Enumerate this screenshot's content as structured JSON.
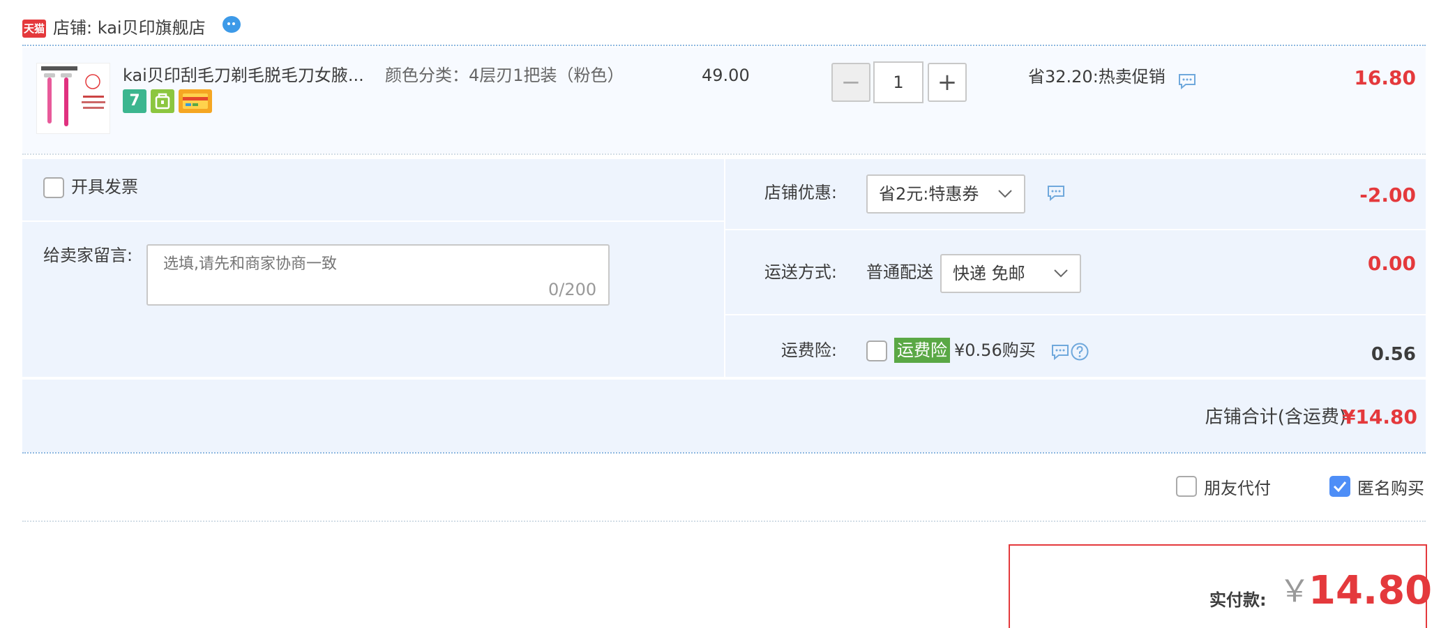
{
  "store": {
    "badge": "天猫",
    "name_text": "店铺: kai贝印旗舰店"
  },
  "item": {
    "title": "kai贝印刮毛刀剃毛脱毛刀女腋...",
    "sku": "颜色分类：4层刃1把装（粉色）",
    "unit_price": "49.00",
    "quantity": "1",
    "promo": "省32.20:热卖促销",
    "total": "16.80",
    "tags": [
      "7",
      "",
      ""
    ],
    "qty_dec_symbol": "−",
    "qty_inc_symbol": "+"
  },
  "invoice": {
    "label": "开具发票"
  },
  "message": {
    "label": "给卖家留言:",
    "placeholder": "选填,请先和商家协商一致",
    "counter": "0/200"
  },
  "discount": {
    "label": "店铺优惠:",
    "selected": "省2元:特惠券",
    "amount": "-2.00"
  },
  "shipping": {
    "label": "运送方式:",
    "type": "普通配送",
    "selected": "快递 免邮",
    "amount": "0.00"
  },
  "insurance": {
    "label": "运费险:",
    "badge": "运费险",
    "price_text": "¥0.56购买",
    "amount": "0.56"
  },
  "store_total": {
    "label": "店铺合计(含运费)",
    "value": "¥14.80"
  },
  "pay_options": {
    "friend_pay": "朋友代付",
    "anonymous": "匿名购买",
    "anonymous_checked": true
  },
  "final": {
    "label": "实付款:",
    "currency": "￥",
    "amount": "14.80"
  },
  "colors": {
    "accent_red": "#e4393c",
    "panel_bg": "#eef4fd",
    "check_blue": "#4e8ef7",
    "insurance_green": "#5aa845"
  }
}
